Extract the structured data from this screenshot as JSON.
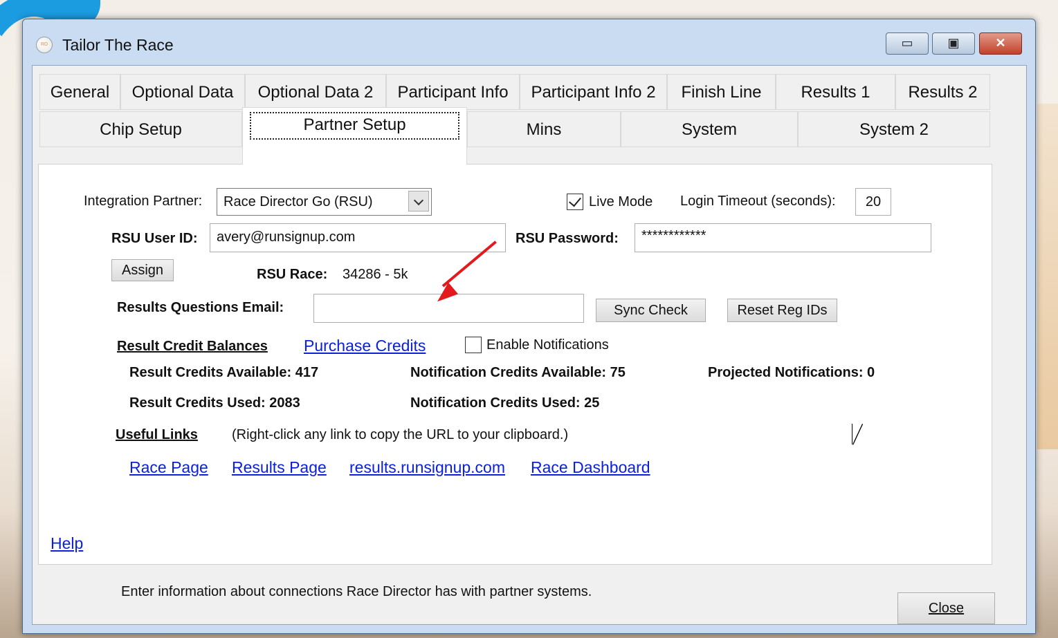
{
  "window": {
    "title": "Tailor The Race",
    "app_icon_text": "RD",
    "minimize_glyph": "▭",
    "maximize_glyph": "▣",
    "close_glyph": "✕"
  },
  "tabs_row1": [
    {
      "label": "General"
    },
    {
      "label": "Optional Data"
    },
    {
      "label": "Optional Data 2"
    },
    {
      "label": "Participant Info"
    },
    {
      "label": "Participant Info 2"
    },
    {
      "label": "Finish Line"
    },
    {
      "label": "Results 1"
    },
    {
      "label": "Results 2"
    }
  ],
  "tabs_row2": [
    {
      "label": "Chip Setup"
    },
    {
      "label": "Partner Setup",
      "active": true
    },
    {
      "label": "Mins"
    },
    {
      "label": "System"
    },
    {
      "label": "System 2"
    }
  ],
  "form": {
    "integration_partner_label": "Integration Partner:",
    "integration_partner_value": "Race Director Go (RSU)",
    "live_mode_label": "Live Mode",
    "live_mode_checked": true,
    "login_timeout_label": "Login Timeout (seconds):",
    "login_timeout_value": "20",
    "rsu_user_id_label": "RSU User ID:",
    "rsu_user_id_value": "avery@runsignup.com",
    "rsu_password_label": "RSU Password:",
    "rsu_password_value": "************",
    "assign_button": "Assign",
    "rsu_race_label": "RSU Race:",
    "rsu_race_value": "34286 - 5k",
    "results_questions_email_label": "Results Questions Email:",
    "results_questions_email_value": "",
    "sync_check_button": "Sync Check",
    "reset_reg_ids_button": "Reset Reg IDs"
  },
  "credits": {
    "heading": "Result Credit Balances",
    "purchase_link": "Purchase Credits",
    "enable_notifications_label": "Enable Notifications",
    "enable_notifications_checked": false,
    "result_credits_available": "Result Credits Available: 417",
    "notification_credits_available": "Notification Credits Available: 75",
    "projected_notifications": "Projected Notifications: 0",
    "result_credits_used": "Result Credits Used: 2083",
    "notification_credits_used": "Notification Credits Used: 25"
  },
  "links": {
    "heading": "Useful Links",
    "hint": "(Right-click any link to copy the URL to your clipboard.)",
    "race_page": "Race Page",
    "results_page": "Results Page",
    "results_site": "results.runsignup.com",
    "race_dashboard": "Race Dashboard"
  },
  "help_link": "Help",
  "footer": {
    "description": "Enter information about connections Race Director has with partner systems.",
    "close_button": "Close"
  },
  "colors": {
    "link": "#0b21d8",
    "annotation_arrow": "#e3191d",
    "title_bar": "#c9dcf2"
  }
}
